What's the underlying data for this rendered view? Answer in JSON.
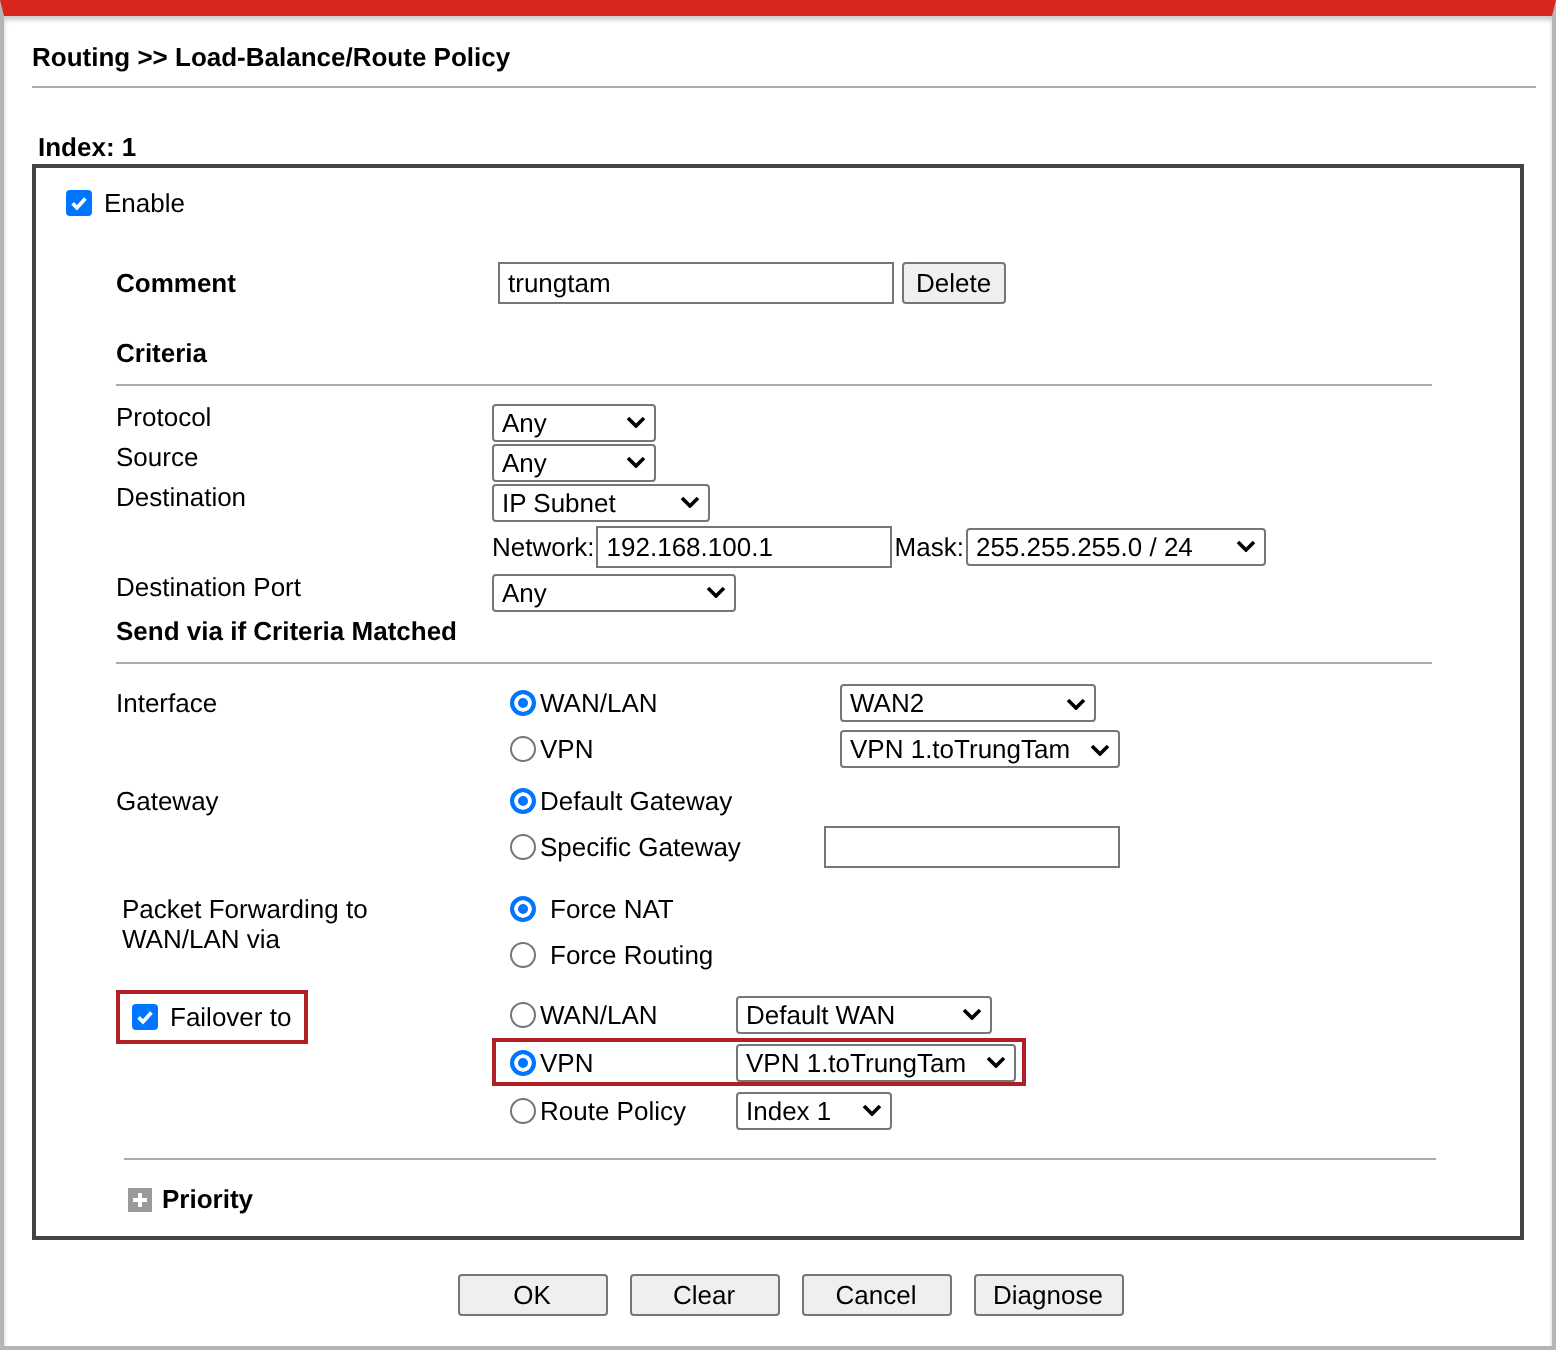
{
  "title": "Routing >> Load-Balance/Route Policy",
  "index_label": "Index: 1",
  "enable": {
    "label": "Enable",
    "checked": true
  },
  "comment": {
    "label": "Comment",
    "value": "trungtam",
    "button": "Delete"
  },
  "criteria": {
    "heading": "Criteria",
    "protocol": {
      "label": "Protocol",
      "value": "Any"
    },
    "source": {
      "label": "Source",
      "value": "Any"
    },
    "destination": {
      "label": "Destination",
      "value": "IP Subnet",
      "network_label": "Network:",
      "network": "192.168.100.1",
      "mask_label": "Mask:",
      "mask": "255.255.255.0 / 24"
    },
    "destination_port": {
      "label": "Destination Port",
      "value": "Any"
    }
  },
  "send_via": {
    "heading": "Send via if Criteria Matched",
    "interface": {
      "label": "Interface",
      "options": [
        {
          "label": "WAN/LAN",
          "selected": true,
          "kind": "select",
          "value": "WAN2"
        },
        {
          "label": "VPN",
          "selected": false,
          "kind": "select",
          "value": "VPN 1.toTrungTam"
        }
      ]
    },
    "gateway": {
      "label": "Gateway",
      "options": [
        {
          "label": "Default Gateway",
          "selected": true,
          "kind": "plain"
        },
        {
          "label": "Specific Gateway",
          "selected": false,
          "kind": "field"
        }
      ]
    },
    "packet_forwarding": {
      "label": "Packet Forwarding to WAN/LAN via",
      "options": [
        {
          "label": "Force NAT",
          "selected": true
        },
        {
          "label": "Force Routing",
          "selected": false
        }
      ]
    },
    "failover": {
      "label": "Failover to",
      "checked": true,
      "highlighted": true,
      "options": [
        {
          "label": "WAN/LAN",
          "selected": false,
          "kind": "select",
          "value": "Default WAN",
          "highlighted": false
        },
        {
          "label": "VPN",
          "selected": true,
          "kind": "select",
          "value": "VPN 1.toTrungTam",
          "highlighted": true
        },
        {
          "label": "Route Policy",
          "selected": false,
          "kind": "select",
          "value": "Index 1",
          "highlighted": false
        }
      ]
    }
  },
  "priority": {
    "label": "Priority",
    "expanded": false
  },
  "buttons": [
    "OK",
    "Clear",
    "Cancel",
    "Diagnose"
  ]
}
